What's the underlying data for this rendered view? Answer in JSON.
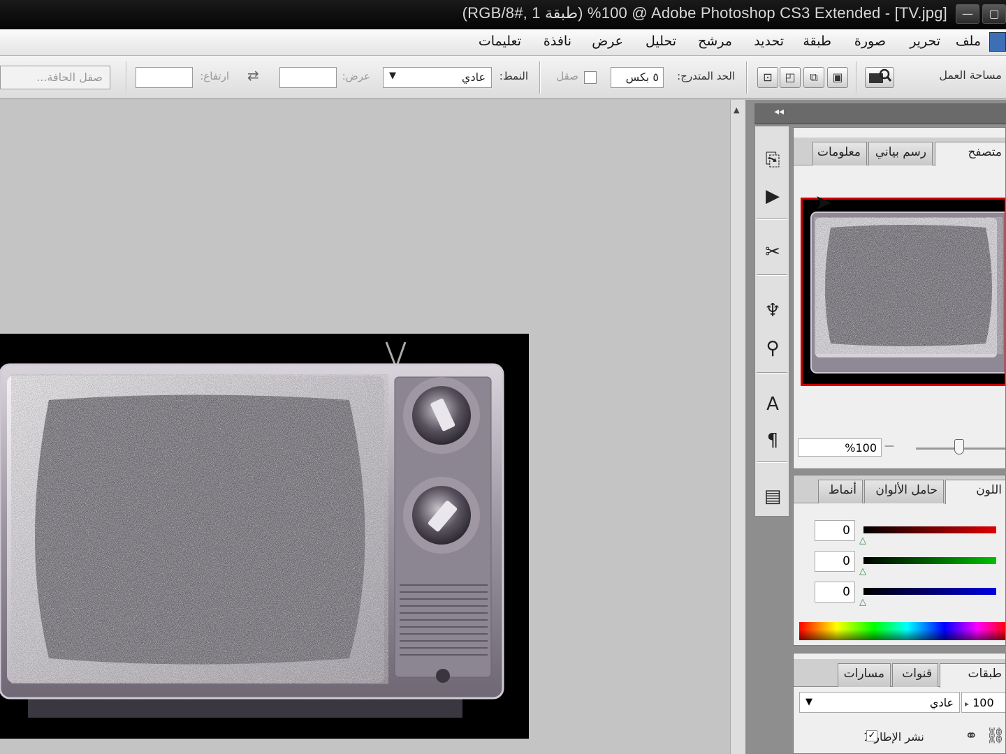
{
  "window": {
    "title": "(RGB/8#, 1 طبقة) %100 @ Adobe Photoshop CS3 Extended - [TV.jpg]",
    "controls": [
      "—",
      "▢"
    ]
  },
  "menu": {
    "items": [
      "ملف",
      "تحرير",
      "صورة",
      "طبقة",
      "تحديد",
      "مرشح",
      "تحليل",
      "عرض",
      "نافذة",
      "تعليمات"
    ]
  },
  "options": {
    "workspace_label": "مساحة العمل",
    "feather_label": "الحد المتدرج:",
    "feather_value": "٥ بكس",
    "antialias_label": "صقل",
    "style_label": "النمط:",
    "style_value": "عادي",
    "width_label": "عرض:",
    "height_label": "ارتفاع:",
    "refine_edge": "صقل الحافة..."
  },
  "panels": {
    "navigator": {
      "tabs": [
        "متصفح",
        "رسم بياني",
        "معلومات"
      ],
      "zoom_value": "%100"
    },
    "color": {
      "tabs": [
        "اللون",
        "حامل الألوان",
        "أنماط"
      ],
      "r": "0",
      "g": "0",
      "b": "0",
      "colors": {
        "r": "#e00000",
        "g": "#00c000",
        "b": "#0000e0"
      }
    },
    "layers": {
      "tabs": [
        "طبقات",
        "قنوات",
        "مسارات"
      ],
      "blend_mode": "عادي",
      "opacity": "100",
      "propagate": "نشر الإطار 1"
    }
  }
}
